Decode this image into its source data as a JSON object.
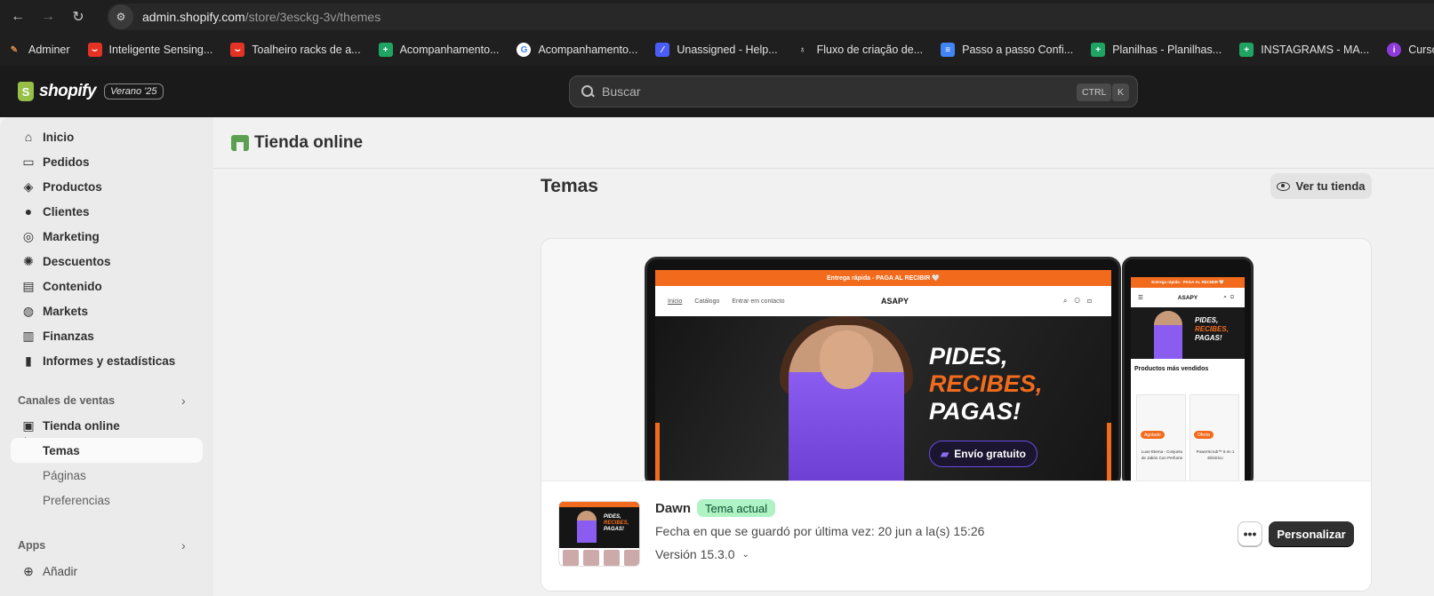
{
  "browser": {
    "url_host": "admin.shopify.com",
    "url_path": "/store/3esckg-3v/themes"
  },
  "bookmarks": [
    {
      "label": "Adminer",
      "icon": "adminer-icon",
      "color": "#1f1f1f"
    },
    {
      "label": "Inteligente Sensing...",
      "icon": "aliexpress-icon",
      "color": "#e43225"
    },
    {
      "label": "Toalheiro racks de a...",
      "icon": "aliexpress-icon",
      "color": "#e43225"
    },
    {
      "label": "Acompanhamento...",
      "icon": "sheets-icon",
      "color": "#1fa463"
    },
    {
      "label": "Acompanhamento...",
      "icon": "google-icon",
      "color": "#ffffff"
    },
    {
      "label": "Unassigned - Help...",
      "icon": "linear-icon",
      "color": "#4a5ef7"
    },
    {
      "label": "Fluxo de criação de...",
      "icon": "person-icon",
      "color": "#1f1f1f"
    },
    {
      "label": "Passo a passo Confi...",
      "icon": "docs-icon",
      "color": "#4285f4"
    },
    {
      "label": "Planilhas - Planilhas...",
      "icon": "sheets-icon",
      "color": "#1fa463"
    },
    {
      "label": "INSTAGRAMS - MA...",
      "icon": "sheets-icon",
      "color": "#1fa463"
    },
    {
      "label": "Curso de Atendime...",
      "icon": "course-icon",
      "color": "#8e3bd9"
    }
  ],
  "topbar": {
    "logo": "shopify",
    "edition": "Verano '25",
    "search_placeholder": "Buscar",
    "shortcut_1": "CTRL",
    "shortcut_2": "K"
  },
  "sidebar": {
    "items": [
      {
        "label": "Inicio",
        "icon": "home-icon"
      },
      {
        "label": "Pedidos",
        "icon": "inbox-icon"
      },
      {
        "label": "Productos",
        "icon": "tag-icon"
      },
      {
        "label": "Clientes",
        "icon": "person-icon"
      },
      {
        "label": "Marketing",
        "icon": "target-icon"
      },
      {
        "label": "Descuentos",
        "icon": "discount-icon"
      },
      {
        "label": "Contenido",
        "icon": "content-icon"
      },
      {
        "label": "Markets",
        "icon": "globe-icon"
      },
      {
        "label": "Finanzas",
        "icon": "bank-icon"
      },
      {
        "label": "Informes y estadísticas",
        "icon": "chart-icon"
      }
    ],
    "sales_channels_label": "Canales de ventas",
    "online_store_label": "Tienda online",
    "sub_items": [
      "Temas",
      "Páginas",
      "Preferencias"
    ],
    "apps_label": "Apps",
    "add_label": "Añadir"
  },
  "page": {
    "header_title": "Tienda online",
    "section_title": "Temas",
    "view_store_label": "Ver tu tienda"
  },
  "preview": {
    "promo_text": "Entrega rápida - PAGA AL RECIBIR 🤍",
    "nav_links": [
      "Inicio",
      "Catálogo",
      "Entrar em contacto"
    ],
    "brand": "ASAPY",
    "hero_line1": "PIDES,",
    "hero_line2": "RECIBES,",
    "hero_line3": "PAGAS!",
    "hero_button": "Envío gratuito",
    "mobile_section": "Productos más vendidos",
    "mobile_tag_1": "Agotado",
    "mobile_tag_2": "Oferta",
    "mobile_product_1": "Luxe Eterna - Conjunto de Jabón Con Perfume",
    "mobile_product_2": "PowerScrub™ 5 en 1 Eléctrico"
  },
  "theme": {
    "name": "Dawn",
    "badge": "Tema actual",
    "saved": "Fecha en que se guardó por última vez: 20 jun a la(s) 15:26",
    "version": "Versión 15.3.0",
    "more_label": "•••",
    "customize_label": "Personalizar"
  }
}
